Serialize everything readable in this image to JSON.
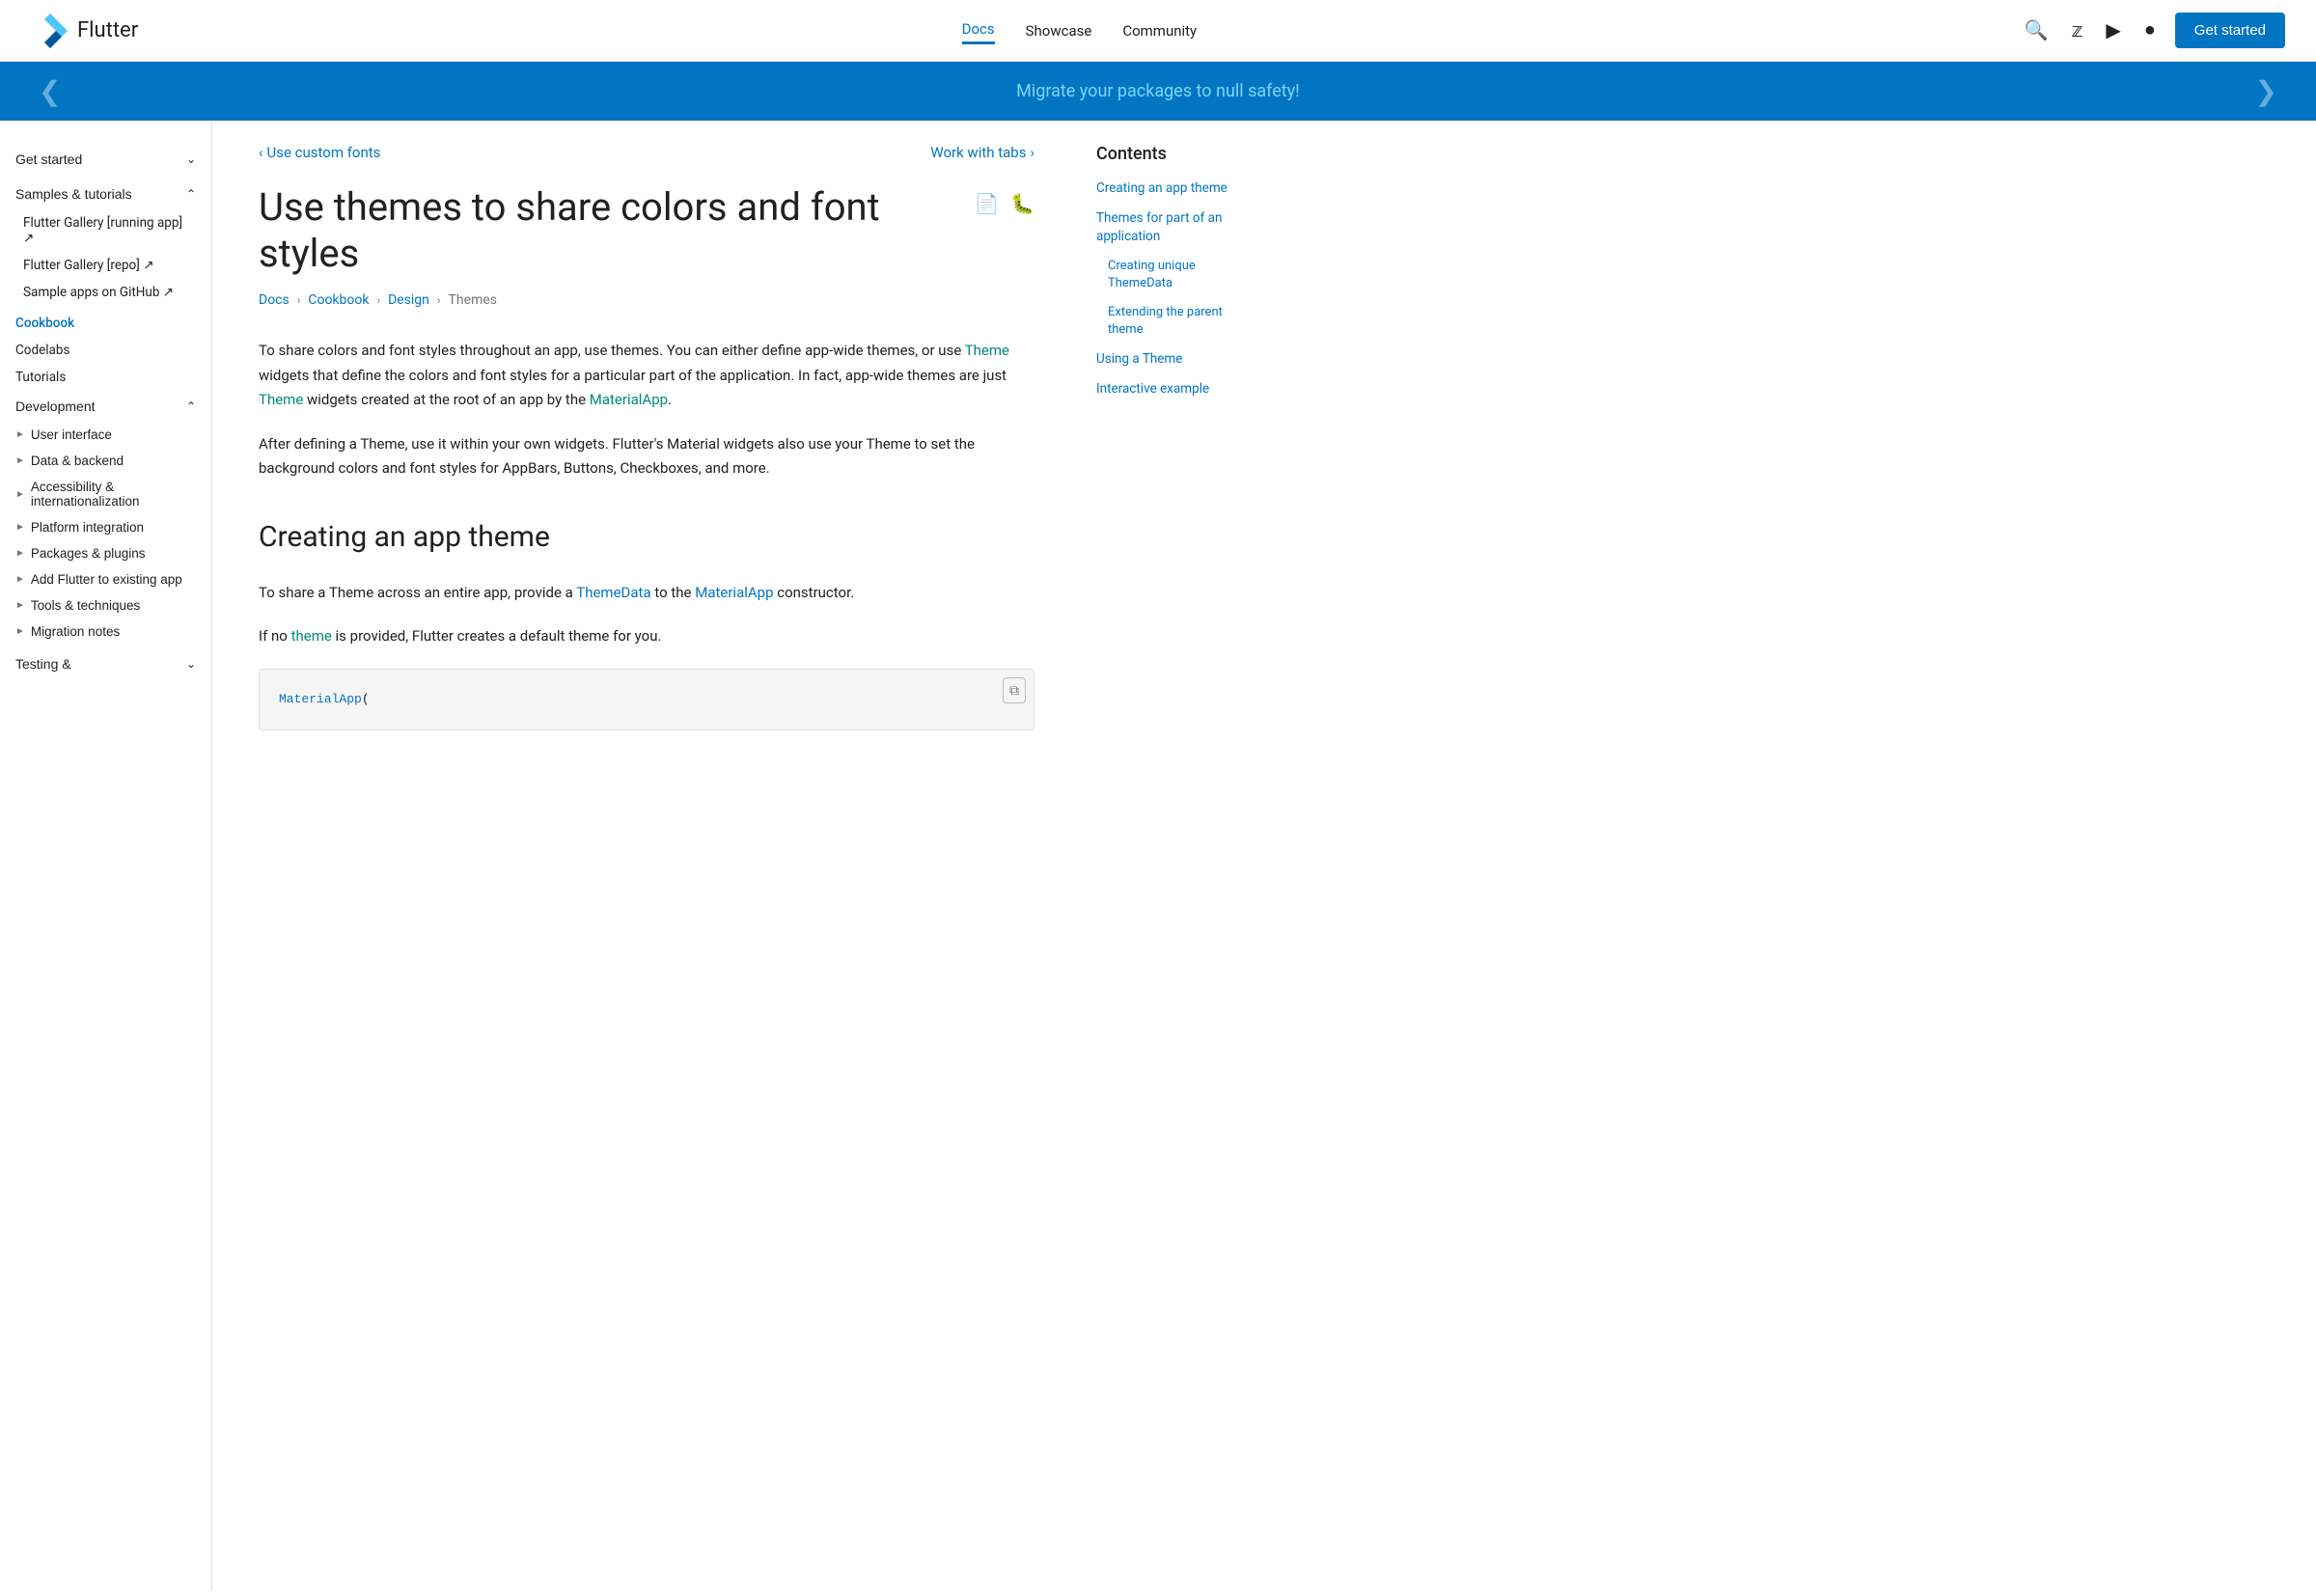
{
  "header": {
    "logo_text": "Flutter",
    "nav": [
      {
        "label": "Docs",
        "active": true
      },
      {
        "label": "Showcase",
        "active": false
      },
      {
        "label": "Community",
        "active": false
      }
    ],
    "get_started_label": "Get started",
    "icons": [
      "search",
      "twitter",
      "youtube",
      "github"
    ]
  },
  "banner": {
    "text": "Migrate your packages to null safety!",
    "arrow_left": "❮",
    "arrow_right": "❯"
  },
  "sidebar": {
    "sections": [
      {
        "label": "Get started",
        "expanded": false,
        "type": "toggle"
      },
      {
        "label": "Samples & tutorials",
        "expanded": true,
        "type": "toggle"
      },
      {
        "items": [
          {
            "label": "Flutter Gallery [running app]",
            "external": true
          },
          {
            "label": "Flutter Gallery [repo]",
            "external": true
          },
          {
            "label": "Sample apps on GitHub",
            "external": true
          }
        ]
      },
      {
        "label": "Cookbook",
        "active": true,
        "type": "link"
      },
      {
        "label": "Codelabs",
        "type": "link"
      },
      {
        "label": "Tutorials",
        "type": "link"
      },
      {
        "label": "Development",
        "expanded": true,
        "type": "toggle"
      },
      {
        "expandable_items": [
          {
            "label": "User interface"
          },
          {
            "label": "Data & backend"
          },
          {
            "label": "Accessibility & internationalization"
          },
          {
            "label": "Platform integration"
          },
          {
            "label": "Packages & plugins"
          },
          {
            "label": "Add Flutter to existing app"
          },
          {
            "label": "Tools & techniques"
          },
          {
            "label": "Migration notes"
          }
        ]
      },
      {
        "label": "Testing &",
        "type": "partial"
      }
    ]
  },
  "page_nav": {
    "prev_label": "Use custom fonts",
    "next_label": "Work with tabs"
  },
  "title": "Use themes to share colors and font styles",
  "title_icons": [
    "file-icon",
    "bug-icon"
  ],
  "breadcrumb": [
    {
      "label": "Docs",
      "link": true
    },
    {
      "label": "Cookbook",
      "link": true
    },
    {
      "label": "Design",
      "link": true
    },
    {
      "label": "Themes",
      "link": false
    }
  ],
  "article": {
    "intro": "To share colors and font styles throughout an app, use themes. You can either define app-wide themes, or use Theme widgets that define the colors and font styles for a particular part of the application. In fact, app-wide themes are just Theme widgets created at the root of an app by the MaterialApp.",
    "inline_links": {
      "Theme": "Theme",
      "MaterialApp": "MaterialApp"
    },
    "paragraph2": "After defining a Theme, use it within your own widgets. Flutter's Material widgets also use your Theme to set the background colors and font styles for AppBars, Buttons, Checkboxes, and more.",
    "section1_title": "Creating an app theme",
    "section1_p1": "To share a Theme across an entire app, provide a ThemeData to the MaterialApp constructor.",
    "section1_p2": "If no theme is provided, Flutter creates a default theme for you.",
    "code_sample": "MaterialApp("
  },
  "contents": {
    "title": "Contents",
    "items": [
      {
        "label": "Creating an app theme",
        "sub": false
      },
      {
        "label": "Themes for part of an application",
        "sub": false
      },
      {
        "label": "Creating unique ThemeData",
        "sub": true
      },
      {
        "label": "Extending the parent theme",
        "sub": true
      },
      {
        "label": "Using a Theme",
        "sub": false
      },
      {
        "label": "Interactive example",
        "sub": false
      }
    ]
  }
}
